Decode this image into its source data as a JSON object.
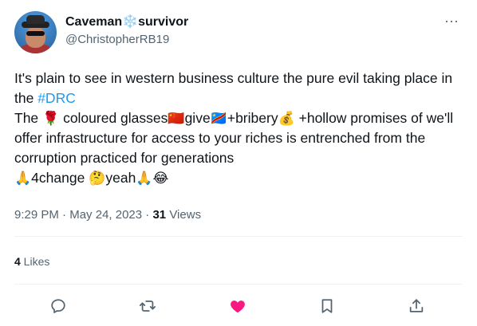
{
  "author": {
    "name_part1": "Caveman",
    "name_symbol": "❄️",
    "name_part2": "survivor",
    "handle": "@ChristopherRB19"
  },
  "more_label": "···",
  "tweet": {
    "line1_text": "It's plain to see in western business culture the pure evil taking place in the ",
    "hashtag": "#DRC",
    "p2_a": "The ",
    "emoji_rose": "🌹",
    "p2_b": " coloured glasses",
    "emoji_china_flag": "🇨🇳",
    "p2_c": "give",
    "emoji_drc_flag": "🇨🇩",
    "p2_d": "+bribery",
    "emoji_moneybag": "💰",
    "p2_e": " +hollow promises of we'll offer infrastructure for access to your riches is entrenched from the corruption practiced for generations",
    "emoji_pray1": "🙏",
    "p3_a": "4change ",
    "emoji_thinking": "🤔",
    "p3_b": "yeah",
    "emoji_pray2": "🙏",
    "emoji_joy": "😂"
  },
  "meta": {
    "time": "9:29 PM",
    "date": "May 24, 2023",
    "views_count": "31",
    "views_label": " Views",
    "sep": " · "
  },
  "likes": {
    "count": "4",
    "label": " Likes"
  },
  "colors": {
    "accent": "#1d9bf0",
    "like": "#f91880",
    "secondary_text": "#536471",
    "divider": "#eff3f4"
  },
  "actions": {
    "reply_icon": "reply-icon",
    "retweet_icon": "retweet-icon",
    "like_icon": "heart-icon",
    "bookmark_icon": "bookmark-icon",
    "share_icon": "share-icon"
  }
}
